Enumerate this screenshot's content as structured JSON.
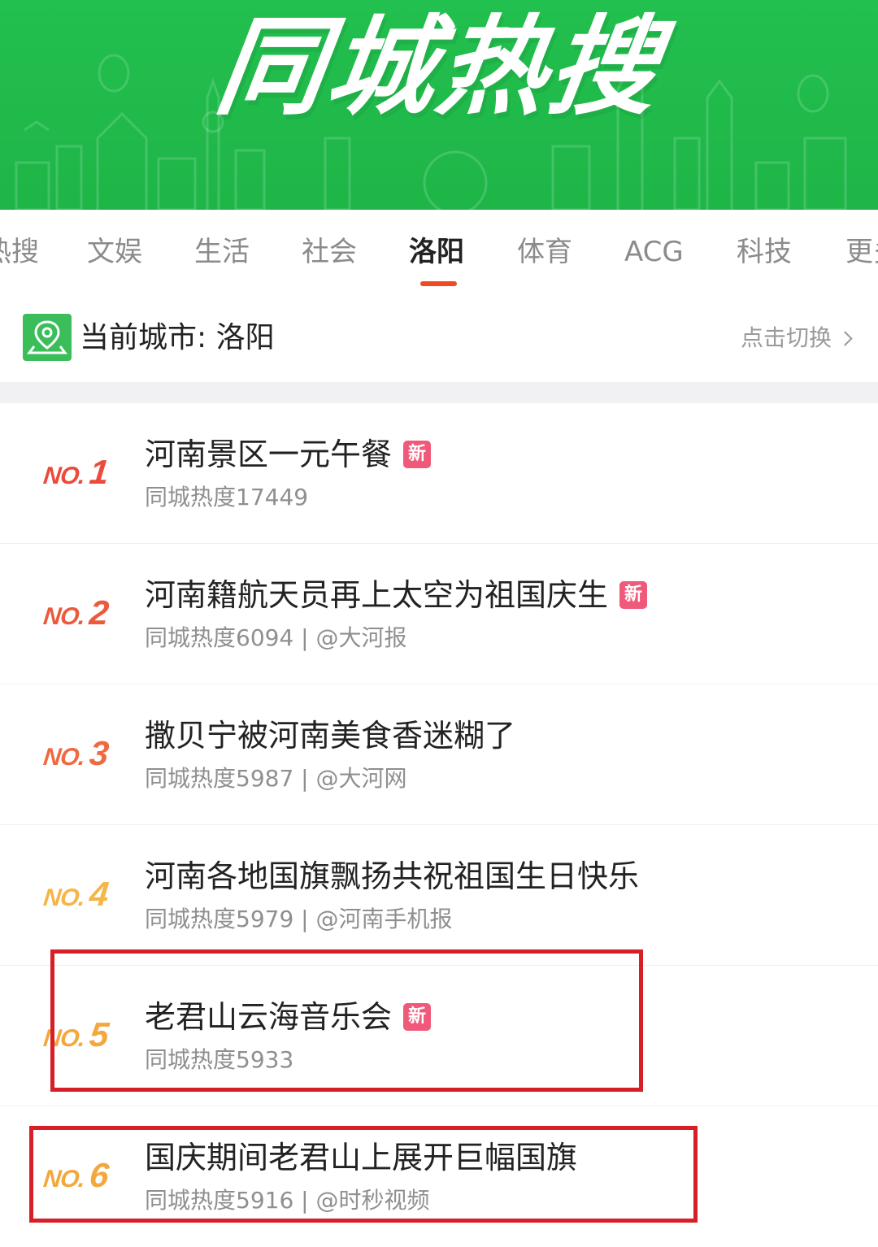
{
  "banner": {
    "title": "同城热搜",
    "bg_color": "#22c04e"
  },
  "tabs": [
    {
      "label": "热搜",
      "active": false
    },
    {
      "label": "文娱",
      "active": false
    },
    {
      "label": "生活",
      "active": false
    },
    {
      "label": "社会",
      "active": false
    },
    {
      "label": "洛阳",
      "active": true
    },
    {
      "label": "体育",
      "active": false
    },
    {
      "label": "ACG",
      "active": false
    },
    {
      "label": "科技",
      "active": false
    },
    {
      "label": "更多",
      "active": false
    }
  ],
  "tab_accent_color": "#f04a23",
  "city": {
    "label": "当前城市: 洛阳",
    "switch_label": "点击切换",
    "icon": "location-pin-icon"
  },
  "items": [
    {
      "rank_prefix": "NO.",
      "rank": "1",
      "title": "河南景区一元午餐",
      "is_new": true,
      "new_label": "新",
      "meta": "同城热度17449",
      "rank_color": "#ea4b3c"
    },
    {
      "rank_prefix": "NO.",
      "rank": "2",
      "title": "河南籍航天员再上太空为祖国庆生",
      "is_new": true,
      "new_label": "新",
      "meta": "同城热度6094 | @大河报",
      "rank_color": "#ec5a3e"
    },
    {
      "rank_prefix": "NO.",
      "rank": "3",
      "title": "撒贝宁被河南美食香迷糊了",
      "is_new": false,
      "new_label": "",
      "meta": "同城热度5987 | @大河网",
      "rank_color": "#ef6a43"
    },
    {
      "rank_prefix": "NO.",
      "rank": "4",
      "title": "河南各地国旗飘扬共祝祖国生日快乐",
      "is_new": false,
      "new_label": "",
      "meta": "同城热度5979 | @河南手机报",
      "rank_color": "#f5b547"
    },
    {
      "rank_prefix": "NO.",
      "rank": "5",
      "title": "老君山云海音乐会",
      "is_new": true,
      "new_label": "新",
      "meta": "同城热度5933",
      "rank_color": "#f3a73d"
    },
    {
      "rank_prefix": "NO.",
      "rank": "6",
      "title": "国庆期间老君山上展开巨幅国旗",
      "is_new": false,
      "new_label": "",
      "meta": "同城热度5916 | @时秒视频",
      "rank_color": "#f3a73d"
    }
  ],
  "highlight_color": "#d61f26"
}
